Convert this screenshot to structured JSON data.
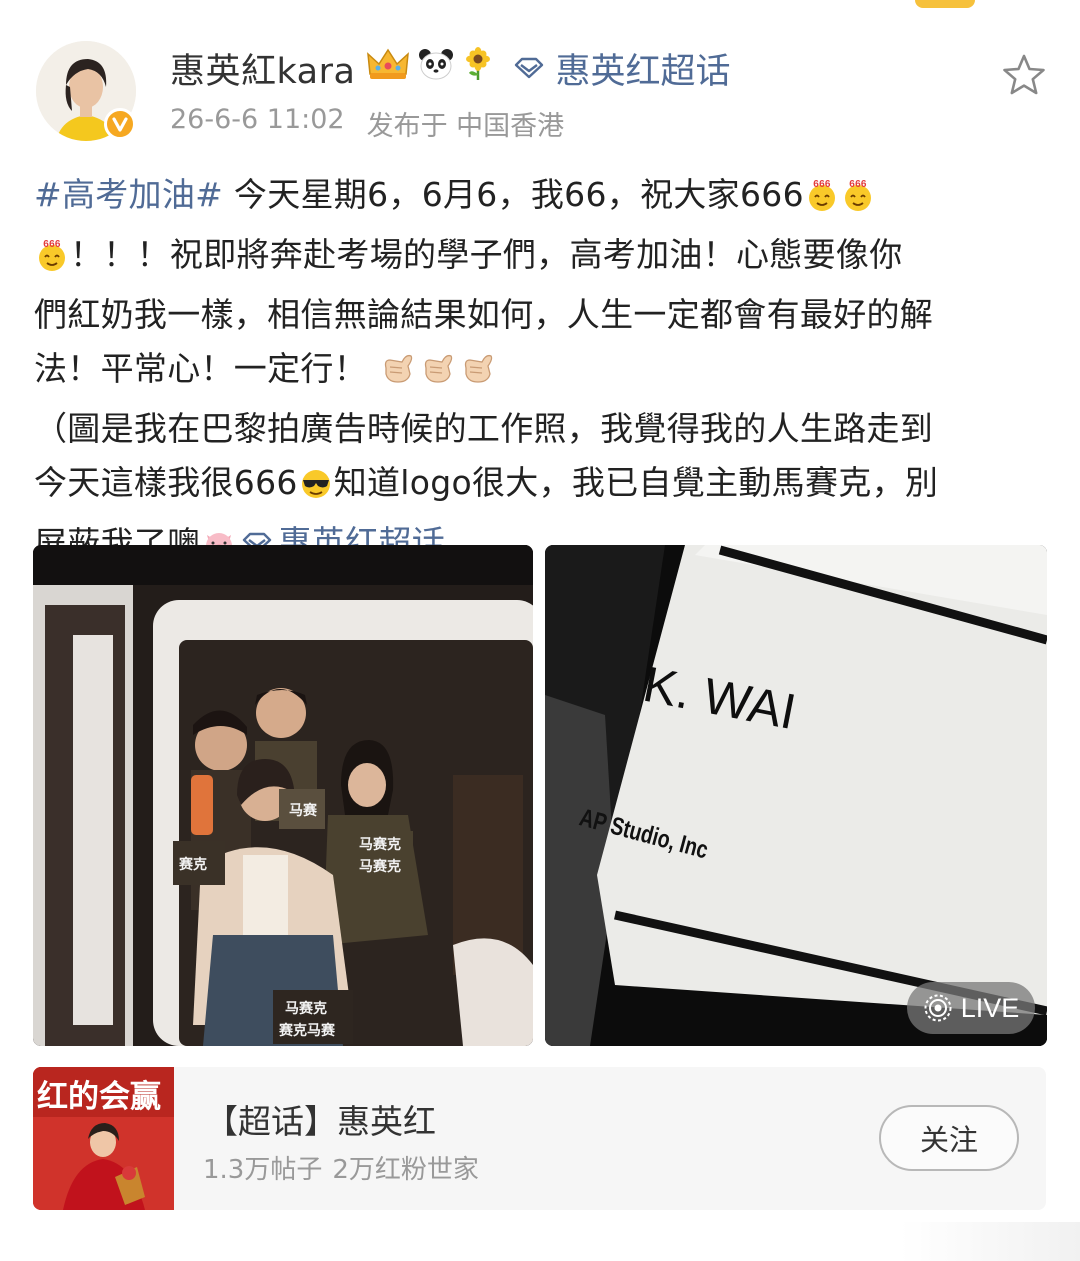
{
  "header": {
    "username": "惠英紅kara",
    "badges": [
      "crown-icon",
      "panda-icon",
      "sunflower-icon"
    ],
    "supertopic_link": "惠英红超话",
    "timestamp": "26-6-6 11:02",
    "location": "发布于 中国香港"
  },
  "post": {
    "hashtag": "#高考加油#",
    "line1_text": " 今天星期6，6月6，我66，祝大家666",
    "line2_text": "！！！祝即將奔赴考場的學子們，高考加油！心態要像你",
    "line3_text": "們紅奶我一樣，相信無論結果如何，人生一定都會有最好的解",
    "line4_text": "法！平常心！一定行！",
    "line5_text": "（圖是我在巴黎拍廣告時候的工作照，我覺得我的人生路走到",
    "line6_pre": "今天這樣我很666",
    "line6_post": "知道logo很大，我已自覺主動馬賽克，別",
    "line7_pre": "屏蔽我了噢",
    "topic_link": "惠英红超话"
  },
  "images": {
    "left": {
      "alt": "mirror selfie",
      "mosaic_labels": [
        "马赛",
        "赛克",
        "马赛克",
        "马赛克",
        "马赛克",
        "赛克马赛"
      ]
    },
    "right": {
      "card_name": "K. WAI",
      "card_company": "AP Studio, Inc",
      "live_label": "LIVE"
    }
  },
  "supertopic_card": {
    "thumb_text": "红的会赢",
    "title": "【超话】惠英红",
    "posts": "1.3万帖子",
    "fans": "2万红粉世家",
    "follow_label": "关注"
  },
  "colors": {
    "link": "#506b96",
    "meta": "#999999",
    "verified": "#f6a821",
    "card_bg": "#f6f6f6"
  }
}
